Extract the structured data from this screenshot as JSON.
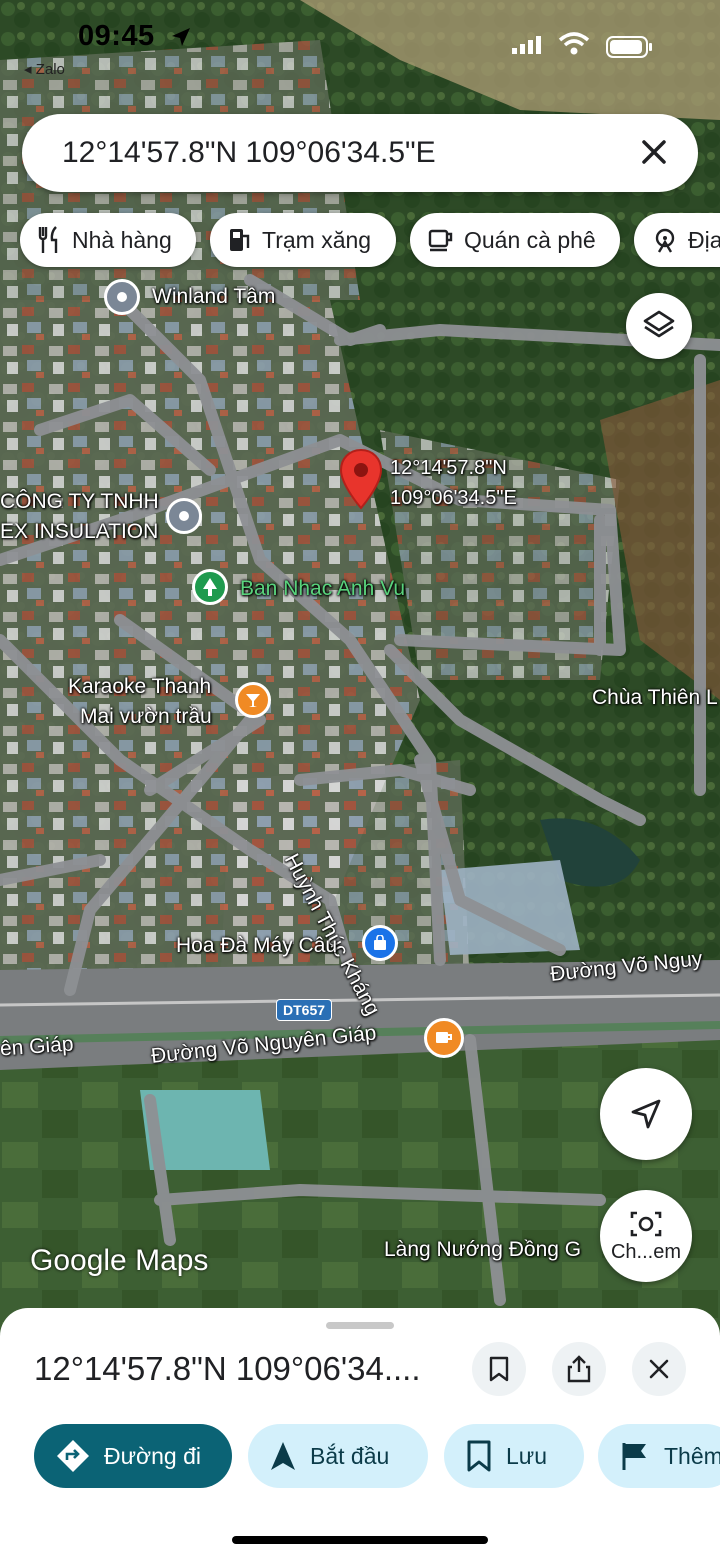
{
  "status_bar": {
    "time": "09:45",
    "back_app": "◂ Zalo"
  },
  "search": {
    "query": "12°14'57.8\"N 109°06'34.5\"E"
  },
  "chips": [
    {
      "label": "Nhà hàng",
      "icon": "fork-knife-icon"
    },
    {
      "label": "Trạm xăng",
      "icon": "gas-station-icon"
    },
    {
      "label": "Quán cà phê",
      "icon": "coffee-cup-icon"
    },
    {
      "label": "Địa",
      "icon": "attraction-icon"
    }
  ],
  "map": {
    "pin": {
      "lat": "12°14'57.8\"N",
      "lng": "109°06'34.5\"E"
    },
    "places": {
      "winland": "Winland Tâm",
      "company_line1": "CÔNG TY TNHH",
      "company_line2": "EX INSULATION",
      "band": "Ban Nhac Anh Vu",
      "karaoke_line1": "Karaoke Thanh",
      "karaoke_line2": "Mai vườn trầu",
      "pagoda": "Chùa Thiên L",
      "hoa_da": "Hoa Đà Máy Câu",
      "lang_nuong": "Làng Nướng Đồng G"
    },
    "roads": {
      "huynh": "Huỳnh Thúc Kháng",
      "vng_main": "Đường Võ Nguyên Giáp",
      "vng_right": "Đường Võ Nguy",
      "vng_left": "ên Giáp",
      "route_badge": "DT657"
    },
    "watermark": "Google Maps",
    "lens_label": "Ch...em"
  },
  "sheet": {
    "title": "12°14'57.8\"N 109°06'34....",
    "actions": [
      {
        "label": "Đường đi",
        "icon": "directions-icon"
      },
      {
        "label": "Bắt đầu",
        "icon": "navigation-arrow-icon"
      },
      {
        "label": "Lưu",
        "icon": "bookmark-icon"
      },
      {
        "label": "Thêm",
        "icon": "flag-icon"
      }
    ]
  },
  "colors": {
    "primary_teal": "#0b6375",
    "chip_bg": "#d3f0fb",
    "pin_red": "#e8342c",
    "poi_gray": "#7b8796",
    "poi_green": "#1f9a4e",
    "poi_orange": "#f08a24",
    "poi_blue": "#1a73e8"
  }
}
